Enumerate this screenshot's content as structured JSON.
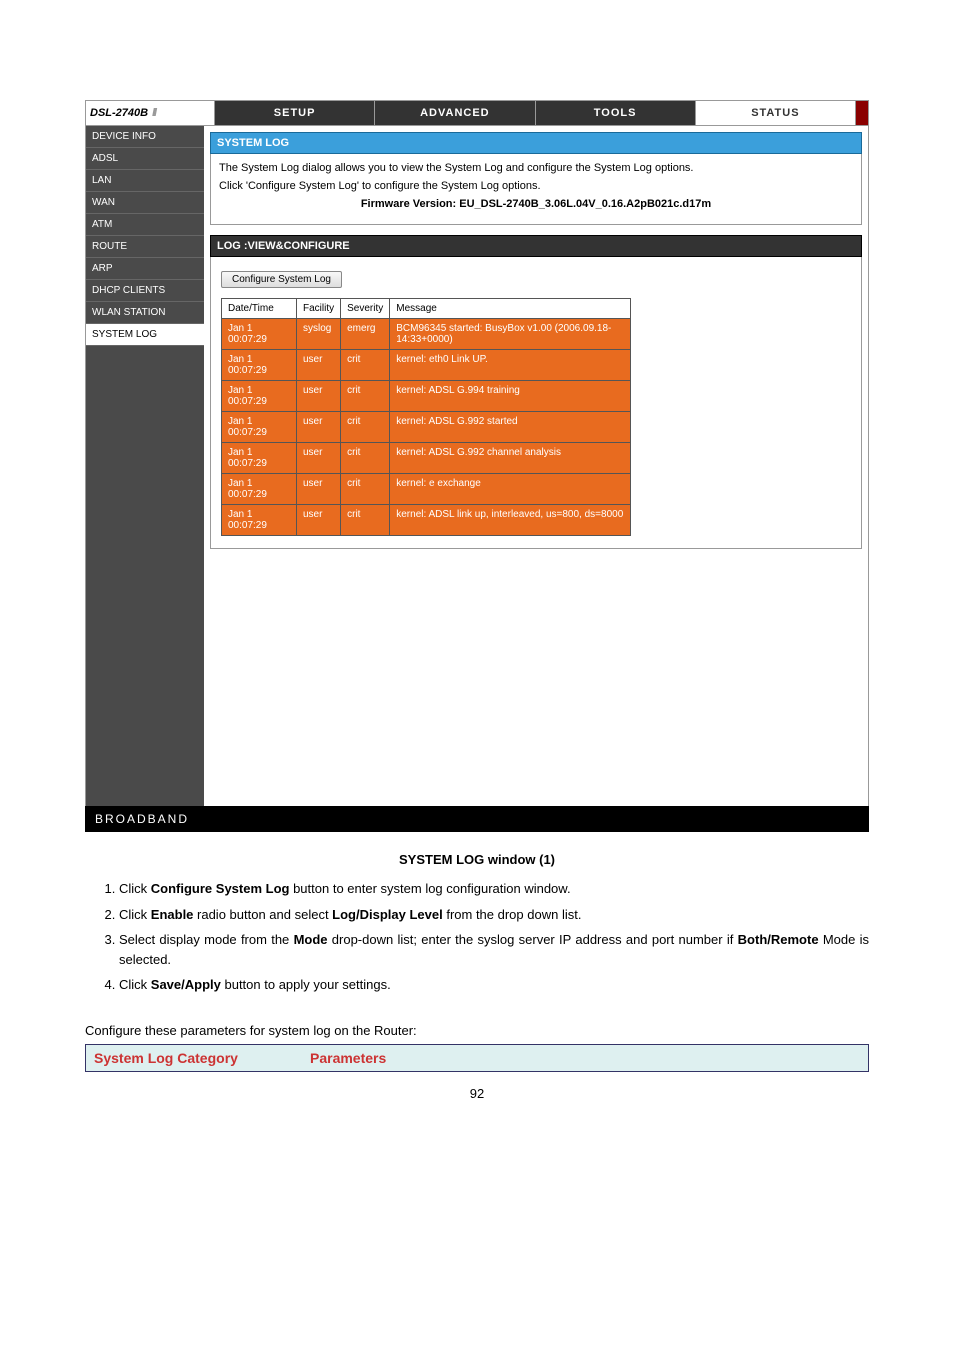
{
  "model": "DSL-2740B",
  "tabs": {
    "setup": "SETUP",
    "advanced": "ADVANCED",
    "tools": "TOOLS",
    "status": "STATUS"
  },
  "sidebar": {
    "device_info": "DEVICE INFO",
    "adsl": "ADSL",
    "lan": "LAN",
    "wan": "WAN",
    "atm": "ATM",
    "route": "ROUTE",
    "arp": "ARP",
    "dhcp": "DHCP CLIENTS",
    "wlan": "WLAN STATION",
    "syslog": "SYSTEM LOG"
  },
  "section": {
    "title": "SYSTEM LOG",
    "desc1": "The System Log dialog allows you to view the System Log and configure the System Log options.",
    "desc2": "Click 'Configure System Log' to configure the System Log options.",
    "firmware_label": "Firmware Version: EU_DSL-2740B_3.06L.04V_0.16.A2pB021c.d17m"
  },
  "logbar": "LOG :VIEW&CONFIGURE",
  "configure_btn": "Configure System Log",
  "log_headers": {
    "dt": "Date/Time",
    "fac": "Facility",
    "sev": "Severity",
    "msg": "Message"
  },
  "log_rows": [
    {
      "dt": "Jan 1 00:07:29",
      "fac": "syslog",
      "sev": "emerg",
      "msg": "BCM96345 started: BusyBox v1.00 (2006.09.18-14:33+0000)"
    },
    {
      "dt": "Jan 1 00:07:29",
      "fac": "user",
      "sev": "crit",
      "msg": "kernel: eth0 Link UP."
    },
    {
      "dt": "Jan 1 00:07:29",
      "fac": "user",
      "sev": "crit",
      "msg": "kernel: ADSL G.994 training"
    },
    {
      "dt": "Jan 1 00:07:29",
      "fac": "user",
      "sev": "crit",
      "msg": "kernel: ADSL G.992 started"
    },
    {
      "dt": "Jan 1 00:07:29",
      "fac": "user",
      "sev": "crit",
      "msg": "kernel: ADSL G.992 channel analysis"
    },
    {
      "dt": "Jan 1 00:07:29",
      "fac": "user",
      "sev": "crit",
      "msg": "kernel: e exchange"
    },
    {
      "dt": "Jan 1 00:07:29",
      "fac": "user",
      "sev": "crit",
      "msg": "kernel: ADSL link up, interleaved, us=800, ds=8000"
    }
  ],
  "footer": "BROADBAND",
  "caption": "SYSTEM LOG window (1)",
  "steps": {
    "s1a": "Click ",
    "s1b": "Configure System Log",
    "s1c": " button to enter system log configuration window.",
    "s2a": "Click ",
    "s2b": "Enable",
    "s2c": " radio button and select ",
    "s2d": "Log/Display Level",
    "s2e": " from the drop down list.",
    "s3a": "Select display mode from the ",
    "s3b": "Mode",
    "s3c": " drop-down list; enter the syslog server IP address and port number if ",
    "s3d": "Both/Remote",
    "s3e": " Mode is selected.",
    "s4a": "Click ",
    "s4b": "Save/Apply",
    "s4c": " button to apply your settings."
  },
  "para": "Configure these parameters for system log on the Router:",
  "param_headers": {
    "cat": "System Log Category",
    "par": "Parameters"
  },
  "pagenum": "92"
}
